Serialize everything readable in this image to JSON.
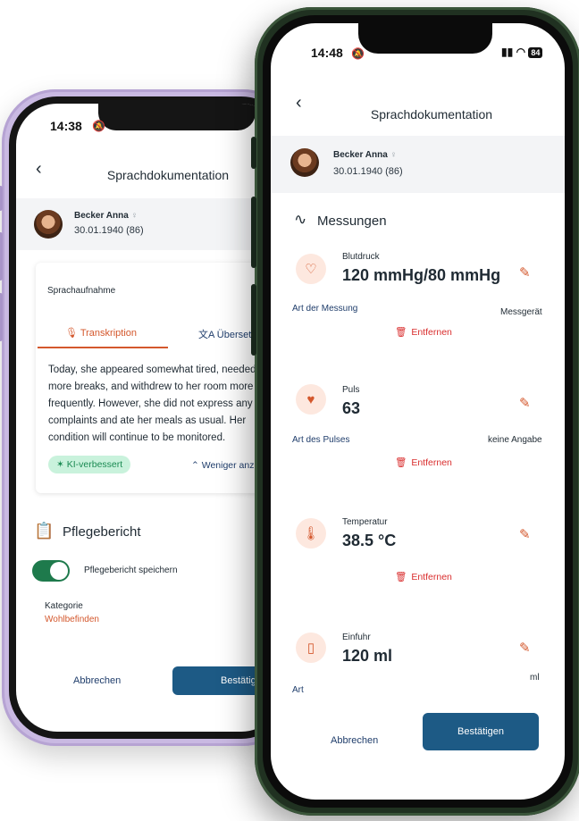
{
  "back_phone": {
    "status_time": "14:38",
    "nav": {
      "back_icon": "chevron-left-icon",
      "title": "Sprachdokumentation"
    },
    "patient": {
      "name": "Becker Anna",
      "gender_symbol": "♀",
      "dob": "30.01.1940 (86)"
    },
    "voice_card": {
      "heading": "Sprachaufnahme",
      "tabs": [
        {
          "label": "Transkription",
          "icon": "microphone-icon"
        },
        {
          "label": "Übersetzu",
          "icon": "translate-icon"
        }
      ],
      "transcript_lines": [
        "Today, she appeared somewhat tired, needed",
        "more breaks, and withdrew to her room more",
        "frequently. However, she did not express any",
        "complaints and ate her meals as usual. Her",
        "condition will continue to be monitored."
      ],
      "ai_badge": "KI-verbessert",
      "less_label": "Weniger anz"
    },
    "care_report": {
      "title": "Pflegebericht",
      "toggle_label": "Pflegebericht speichern",
      "toggle_on": true,
      "category_label": "Kategorie",
      "category_value": "Wohlbefinden"
    },
    "footer": {
      "cancel": "Abbrechen",
      "confirm": "Bestätigen"
    }
  },
  "front_phone": {
    "status_time": "14:48",
    "battery": "84",
    "nav": {
      "back_icon": "chevron-left-icon",
      "title": "Sprachdokumentation"
    },
    "patient": {
      "name": "Becker Anna",
      "gender_symbol": "♀",
      "dob": "30.01.1940 (86)"
    },
    "section_title": "Messungen",
    "measurements": [
      {
        "label": "Blutdruck",
        "value": "120 mmHg/80 mmHg",
        "icon": "heart-pulse-icon",
        "type_label": "Art der Messung",
        "type_value": "Messgerät",
        "remove": "Entfernen"
      },
      {
        "label": "Puls",
        "value": "63",
        "icon": "pulse-heart-icon",
        "type_label": "Art des Pulses",
        "type_value": "keine Angabe",
        "remove": "Entfernen"
      },
      {
        "label": "Temperatur",
        "value": "38.5 °C",
        "icon": "thermometer-icon",
        "remove": "Entfernen"
      },
      {
        "label": "Einfuhr",
        "value": "120 ml",
        "icon": "cup-icon",
        "type_label": "Art",
        "type_value": "ml"
      }
    ],
    "footer": {
      "cancel": "Abbrechen",
      "confirm": "Bestätigen"
    }
  },
  "colors": {
    "accent": "#d4582d",
    "primary": "#1d5a85",
    "success": "#1e7a4c",
    "danger": "#d92d2d"
  }
}
